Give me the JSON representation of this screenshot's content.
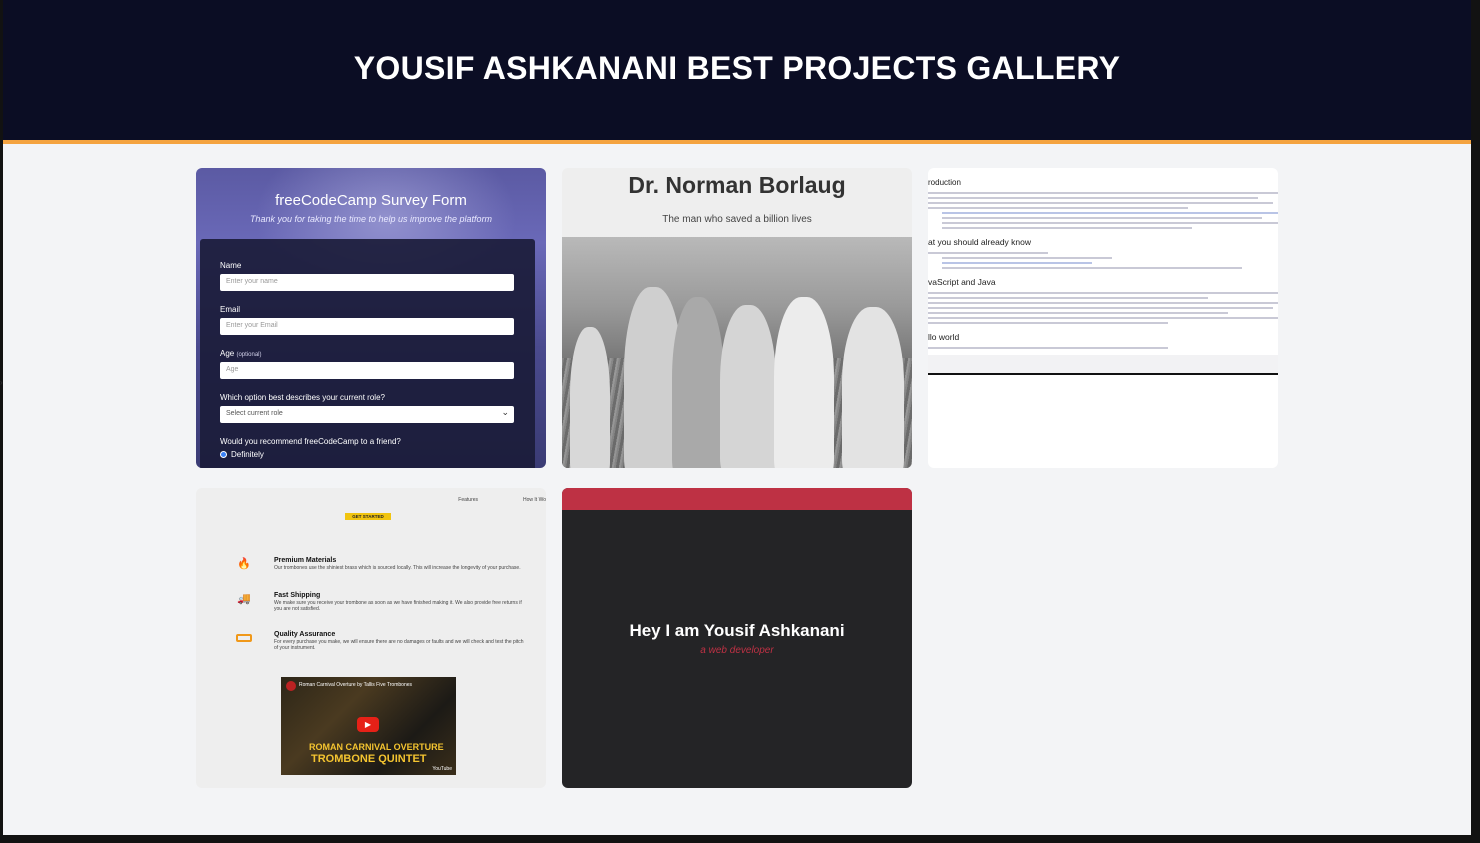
{
  "header": {
    "title": "YOUSIF ASHKANANI BEST PROJECTS GALLERY"
  },
  "colors": {
    "header_bg": "#0b0d24",
    "accent": "#f4a340",
    "page_bg": "#f3f4f6",
    "portfolio_red": "#be3144"
  },
  "projects": [
    {
      "kind": "survey-form",
      "title": "freeCodeCamp Survey Form",
      "subtitle": "Thank you for taking the time to help us improve the platform",
      "fields": [
        {
          "label": "Name",
          "placeholder": "Enter your name"
        },
        {
          "label": "Email",
          "placeholder": "Enter your Email"
        },
        {
          "label": "Age",
          "label_note": "(optional)",
          "placeholder": "Age"
        }
      ],
      "select_label": "Which option best describes your current role?",
      "select_value": "Select current role",
      "radio_question": "Would you recommend freeCodeCamp to a friend?",
      "radio_first": "Definitely"
    },
    {
      "kind": "tribute-page",
      "title": "Dr. Norman Borlaug",
      "subtitle": "The man who saved a billion lives"
    },
    {
      "kind": "documentation-page",
      "headings": [
        "roduction",
        "at you should already know",
        "vaScript and Java",
        "llo world"
      ]
    },
    {
      "kind": "product-landing-page",
      "cta": "GET STARTED",
      "nav": [
        "Features",
        "How It Wo"
      ],
      "features": [
        {
          "icon": "fire-icon",
          "title": "Premium Materials",
          "text": "Our trombones use the shiniest brass which is sourced locally. This will increase the longevity of your purchase."
        },
        {
          "icon": "truck-icon",
          "title": "Fast Shipping",
          "text": "We make sure you receive your trombone as soon as we have finished making it. We also provide free returns if you are not satisfied."
        },
        {
          "icon": "battery-icon",
          "title": "Quality Assurance",
          "text": "For every purchase you make, we will ensure there are no damages or faults and we will check and test the pitch of your instrument."
        }
      ],
      "video": {
        "title": "Roman Carnival Overture by Tallis Five Trombones",
        "line1": "ROMAN CARNIVAL OVERTURE",
        "line2": "TROMBONE QUINTET",
        "brand": "YouTube"
      }
    },
    {
      "kind": "portfolio",
      "name": "Hey I am Yousif Ashkanani",
      "role": "a web developer"
    }
  ]
}
